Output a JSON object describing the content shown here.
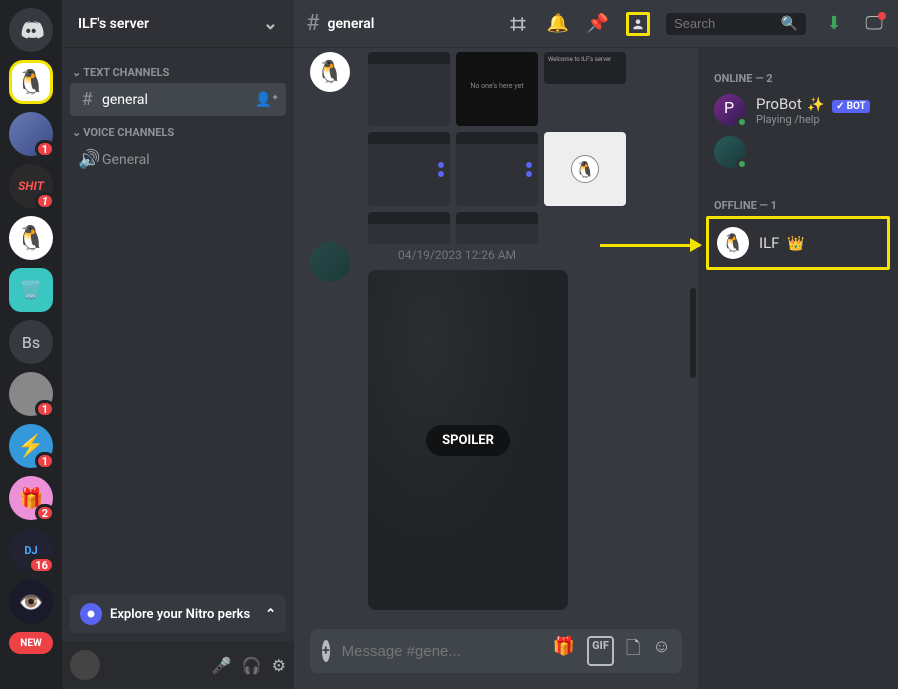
{
  "server_header": {
    "name": "ILF's server"
  },
  "channels": {
    "text_label": "TEXT CHANNELS",
    "voice_label": "VOICE CHANNELS",
    "text": [
      {
        "name": "general"
      }
    ],
    "voice": [
      {
        "name": "General"
      }
    ]
  },
  "nitro": {
    "label": "Explore your Nitro perks"
  },
  "topbar": {
    "channel": "general",
    "search_placeholder": "Search"
  },
  "servers": {
    "bs_label": "Bs",
    "shit_label": "SHIT",
    "new_label": "NEW",
    "badges": {
      "b1": "1",
      "b2": "1",
      "b3": "1",
      "b4": "1",
      "b5": "2",
      "b6": "16"
    }
  },
  "messages": {
    "ts1": "04/19/2023 12:26 AM",
    "spoiler_label": "SPOILER"
  },
  "input": {
    "placeholder": "Message #gene..."
  },
  "members": {
    "online_label": "ONLINE — 2",
    "offline_label": "OFFLINE — 1",
    "probot": {
      "name": "ProBot",
      "activity": "Playing /help",
      "bot_tag": "BOT"
    },
    "ilf": {
      "name": "ILF"
    }
  }
}
